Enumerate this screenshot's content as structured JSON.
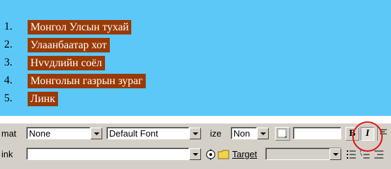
{
  "list_items": [
    {
      "num": "1.",
      "text": "Монгол Улсын тухай"
    },
    {
      "num": "2.",
      "text": "Улаанбаатар хот"
    },
    {
      "num": "3.",
      "text": "Нvvдлийн соёл"
    },
    {
      "num": "4.",
      "text": "Монголын газрын зураг"
    },
    {
      "num": "5.",
      "text": "Линк"
    }
  ],
  "toolbar": {
    "format_label": "mat",
    "format_value": "None",
    "font_value": "Default Font",
    "size_label": "ize",
    "size_value": "Non",
    "bold_label": "B",
    "italic_label": "I",
    "link_label": "ink",
    "link_value": "",
    "target_label": "Target",
    "target_value": ""
  },
  "colors": {
    "canvas_bg": "#5bc8f7",
    "highlight": "#9a3a07",
    "circle": "#e01010"
  }
}
